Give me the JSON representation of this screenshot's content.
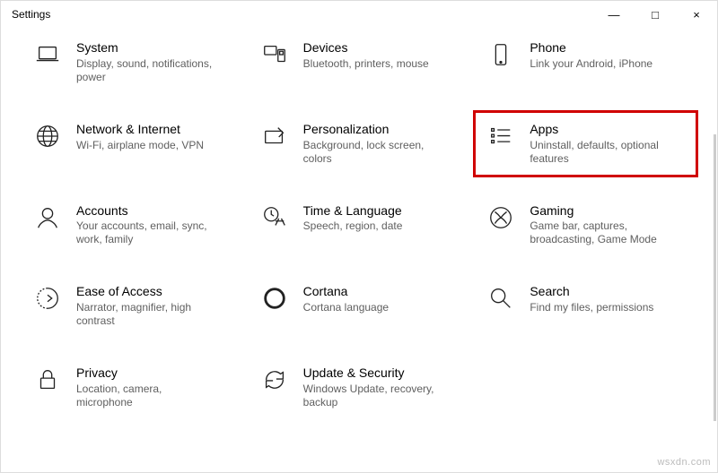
{
  "window": {
    "title": "Settings",
    "minimize": "—",
    "maximize": "□",
    "close": "×"
  },
  "tiles": {
    "system": {
      "title": "System",
      "desc": "Display, sound, notifications, power"
    },
    "devices": {
      "title": "Devices",
      "desc": "Bluetooth, printers, mouse"
    },
    "phone": {
      "title": "Phone",
      "desc": "Link your Android, iPhone"
    },
    "network": {
      "title": "Network & Internet",
      "desc": "Wi-Fi, airplane mode, VPN"
    },
    "personal": {
      "title": "Personalization",
      "desc": "Background, lock screen, colors"
    },
    "apps": {
      "title": "Apps",
      "desc": "Uninstall, defaults, optional features"
    },
    "accounts": {
      "title": "Accounts",
      "desc": "Your accounts, email, sync, work, family"
    },
    "time": {
      "title": "Time & Language",
      "desc": "Speech, region, date"
    },
    "gaming": {
      "title": "Gaming",
      "desc": "Game bar, captures, broadcasting, Game Mode"
    },
    "ease": {
      "title": "Ease of Access",
      "desc": "Narrator, magnifier, high contrast"
    },
    "cortana": {
      "title": "Cortana",
      "desc": "Cortana language"
    },
    "search": {
      "title": "Search",
      "desc": "Find my files, permissions"
    },
    "privacy": {
      "title": "Privacy",
      "desc": "Location, camera, microphone"
    },
    "update": {
      "title": "Update & Security",
      "desc": "Windows Update, recovery, backup"
    }
  },
  "watermark": "wsxdn.com"
}
